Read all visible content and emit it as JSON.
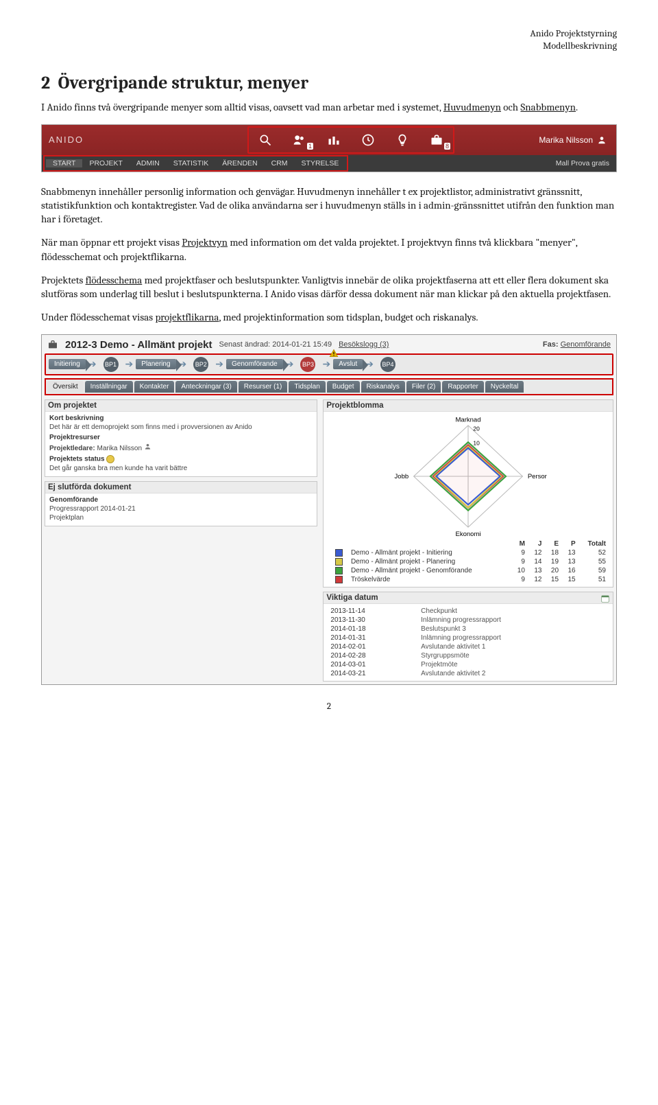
{
  "doc": {
    "header_line1": "Anido Projektstyrning",
    "header_line2": "Modellbeskrivning",
    "heading_no": "2",
    "heading": "Övergripande struktur, menyer",
    "p1_a": "I Anido finns två övergripande menyer som alltid visas, oavsett vad man arbetar med i systemet, ",
    "p1_b": "Huvudmenyn",
    "p1_c": " och ",
    "p1_d": "Snabbmenyn",
    "p1_e": ".",
    "p2": "Snabbmenyn innehåller personlig information och genvägar. Huvudmenyn innehåller t ex projektlistor, administrativt gränssnitt, statistikfunktion och kontaktregister. Vad de olika användarna ser i huvudmenyn ställs in i admin-gränssnittet utifrån den funktion man har i företaget.",
    "p3_a": "När man öppnar ett projekt visas ",
    "p3_b": "Projektvyn",
    "p3_c": " med information om det valda projektet. I projektvyn finns två klickbara \"menyer\", flödesschemat och projektflikarna.",
    "p4_a": "Projektets ",
    "p4_b": "flödesschema",
    "p4_c": " med projektfaser och beslutspunkter. Vanligtvis innebär de olika projektfaserna att ett eller flera dokument ska slutföras som underlag till beslut i beslutspunkterna. I Anido visas därför dessa dokument när man klickar på den aktuella projektfasen.",
    "p5_a": "Under flödesschemat visas ",
    "p5_b": "projektflikarna",
    "p5_c": ", med projektinformation som tidsplan, budget och riskanalys.",
    "page_no": "2"
  },
  "appbar": {
    "logo": "ANIDO",
    "badges": {
      "people": "1",
      "briefcase": "8"
    },
    "user": "Marika Nilsson",
    "menu": [
      "START",
      "PROJEKT",
      "ADMIN",
      "STATISTIK",
      "ÄRENDEN",
      "CRM",
      "STYRELSE"
    ],
    "right": "Mall Prova gratis"
  },
  "project": {
    "code": "2012-3",
    "title": "Demo - Allmänt projekt",
    "last_changed_label": "Senast ändrad:",
    "last_changed": "2014-01-21 15:49",
    "visitlog": "Besökslogg (3)",
    "phase_label": "Fas:",
    "phase_value": "Genomförande",
    "phases": [
      "Initiering",
      "Planering",
      "Genomförande",
      "Avslut"
    ],
    "bps": [
      "BP1",
      "BP2",
      "BP3",
      "BP4"
    ],
    "tabs": [
      "Översikt",
      "Inställningar",
      "Kontakter",
      "Anteckningar (3)",
      "Resurser (1)",
      "Tidsplan",
      "Budget",
      "Riskanalys",
      "Filer (2)",
      "Rapporter",
      "Nyckeltal"
    ],
    "about": {
      "title": "Om projektet",
      "short_label": "Kort beskrivning",
      "short": "Det här är ett demoprojekt som finns med i provversionen av Anido",
      "res_label": "Projektresurser",
      "leader_label": "Projektledare:",
      "leader": "Marika Nilsson",
      "status_label": "Projektets status",
      "status_text": "Det går ganska bra men kunde ha varit bättre"
    },
    "unfinished": {
      "title": "Ej slutförda dokument",
      "phase": "Genomförande",
      "items": [
        "Progressrapport 2014-01-21",
        "Projektplan"
      ]
    },
    "blomma": {
      "title": "Projektblomma",
      "axes": [
        "Marknad",
        "Personal",
        "Ekonomi",
        "Jobb"
      ],
      "scale": [
        "10",
        "20"
      ]
    },
    "legend": {
      "headers": [
        "M",
        "J",
        "E",
        "P",
        "Totalt"
      ],
      "rows": [
        {
          "color": "#3b5bd1",
          "name": "Demo - Allmänt projekt - Initiering",
          "v": [
            9,
            12,
            18,
            13,
            52
          ]
        },
        {
          "color": "#d7c947",
          "name": "Demo - Allmänt projekt - Planering",
          "v": [
            9,
            14,
            19,
            13,
            55
          ]
        },
        {
          "color": "#3da23d",
          "name": "Demo - Allmänt projekt - Genomförande",
          "v": [
            10,
            13,
            20,
            16,
            59
          ]
        },
        {
          "color": "#d13a3a",
          "name": "Tröskelvärde",
          "v": [
            9,
            12,
            15,
            15,
            51
          ]
        }
      ]
    },
    "dates": {
      "title": "Viktiga datum",
      "rows": [
        [
          "2013-11-14",
          "Checkpunkt"
        ],
        [
          "2013-11-30",
          "Inlämning progressrapport"
        ],
        [
          "2014-01-18",
          "Beslutspunkt 3"
        ],
        [
          "2014-01-31",
          "Inlämning progressrapport"
        ],
        [
          "2014-02-01",
          "Avslutande aktivitet 1"
        ],
        [
          "2014-02-28",
          "Styrgruppsmöte"
        ],
        [
          "2014-03-01",
          "Projektmöte"
        ],
        [
          "2014-03-21",
          "Avslutande aktivitet 2"
        ]
      ]
    }
  }
}
